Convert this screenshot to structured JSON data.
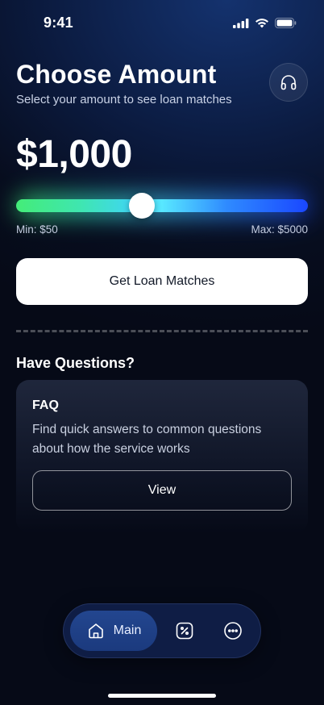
{
  "status_bar": {
    "time": "9:41"
  },
  "header": {
    "title": "Choose Amount",
    "subtitle": "Select your amount to see loan matches",
    "support_icon": "headphones-icon"
  },
  "amount": {
    "display": "$1,000",
    "value": 1000,
    "min": 50,
    "max": 5000
  },
  "range": {
    "min_label": "Min: $50",
    "max_label": "Max: $5000"
  },
  "cta": {
    "label": "Get Loan Matches"
  },
  "questions": {
    "section_title": "Have Questions?",
    "faq": {
      "title": "FAQ",
      "description": "Find quick answers to common questions about how the service works",
      "button_label": "View"
    }
  },
  "tabbar": {
    "items": [
      {
        "label": "Main",
        "icon": "home-icon",
        "active": true
      },
      {
        "label": "",
        "icon": "percent-icon",
        "active": false
      },
      {
        "label": "",
        "icon": "more-icon",
        "active": false
      }
    ]
  },
  "colors": {
    "slider_start": "#44ec78",
    "slider_mid": "#3fd6f3",
    "slider_end": "#1a47ff",
    "background": "#070d1e",
    "tabbar_active": "#1b3a7e"
  }
}
